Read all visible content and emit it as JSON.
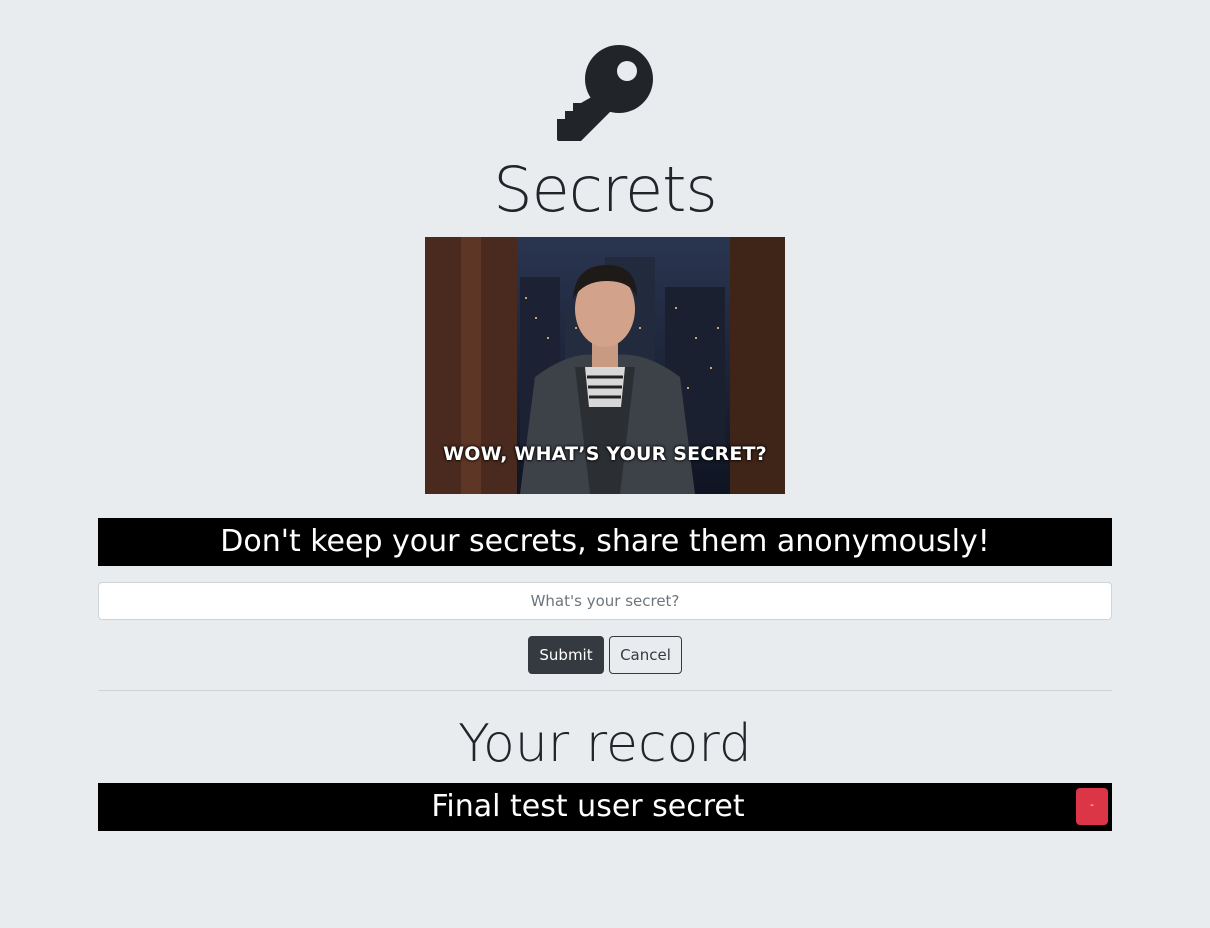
{
  "header": {
    "icon": "key-icon",
    "title": "Secrets"
  },
  "gif": {
    "caption": "WOW, WHAT’S YOUR SECRET?"
  },
  "banner": {
    "text": "Don't keep your secrets, share them anonymously!"
  },
  "form": {
    "placeholder": "What's your secret?",
    "value": "",
    "submit_label": "Submit",
    "cancel_label": "Cancel"
  },
  "record": {
    "title": "Your record",
    "items": [
      {
        "text": "Final test user secret",
        "delete_label": "-"
      }
    ]
  },
  "colors": {
    "background": "#e9ecef",
    "banner": "#000000",
    "primary_button": "#343a40",
    "delete_button": "#dc3545"
  }
}
